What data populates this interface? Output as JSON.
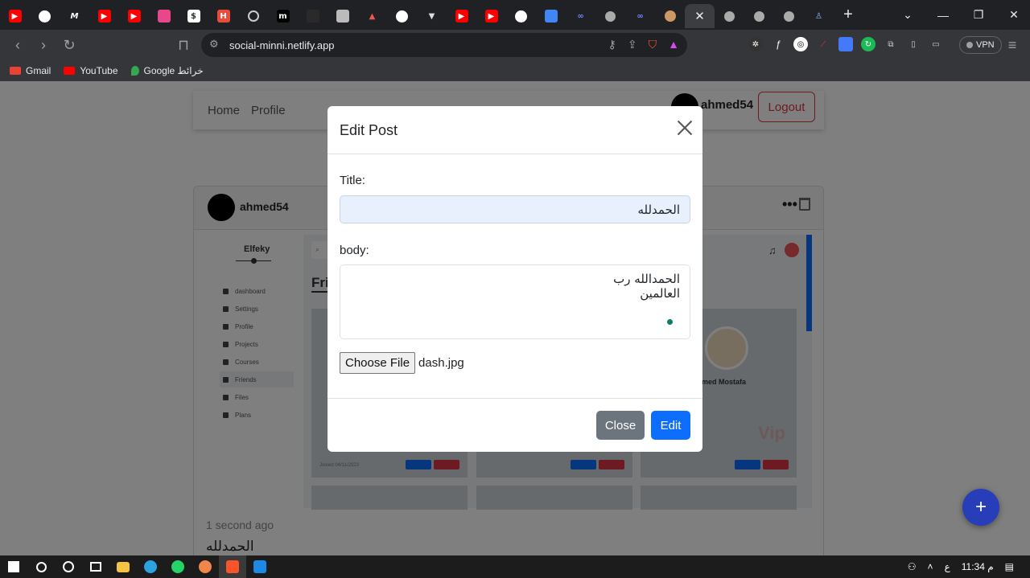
{
  "browser": {
    "tab_favicons": [
      "youtube-icon",
      "github-icon",
      "medium-icon",
      "youtube-icon",
      "youtube-icon",
      "app-icon",
      "app-icon",
      "app-icon",
      "chatgpt-icon",
      "app-icon",
      "app-icon",
      "app-icon",
      "app-icon",
      "github-icon",
      "vue-icon",
      "youtube-icon",
      "youtube-icon",
      "github-icon",
      "docs-icon",
      "app-icon",
      "app-icon",
      "app-icon",
      "app-icon"
    ],
    "new_tab_label": "+",
    "url": "social-minni.netlify.app",
    "vpn_label": "VPN",
    "bookmarks": [
      {
        "label": "Gmail"
      },
      {
        "label": "YouTube"
      },
      {
        "label": "Google خرائط"
      }
    ]
  },
  "navbar": {
    "home": "Home",
    "profile": "Profile",
    "username": "ahmed54",
    "logout": "Logout"
  },
  "post": {
    "username": "ahmed54",
    "dots": "•••",
    "time": "1 second ago",
    "title": "الحمدلله",
    "preview": {
      "brand": "Elfeky",
      "menu": [
        "dashboard",
        "Settings",
        "Profile",
        "Projects",
        "Courses",
        "Friends",
        "Files",
        "Plans"
      ],
      "heading": "Fri",
      "friend_name": "med Mostafa",
      "friend_role": "Vip",
      "joined": "Joined 04/11/2023",
      "btn_profile": "Profile",
      "btn_remove": "Remove"
    }
  },
  "modal": {
    "title": "Edit Post",
    "title_label": "Title:",
    "title_value": "الحمدلله",
    "body_label": "body:",
    "body_value": "الحمدالله رب العالمين",
    "file_button": "Choose File",
    "file_name": "dash.jpg",
    "close_button": "Close",
    "edit_button": "Edit"
  },
  "fab": "+",
  "taskbar": {
    "time": "11:34 م",
    "lang": "ع"
  }
}
